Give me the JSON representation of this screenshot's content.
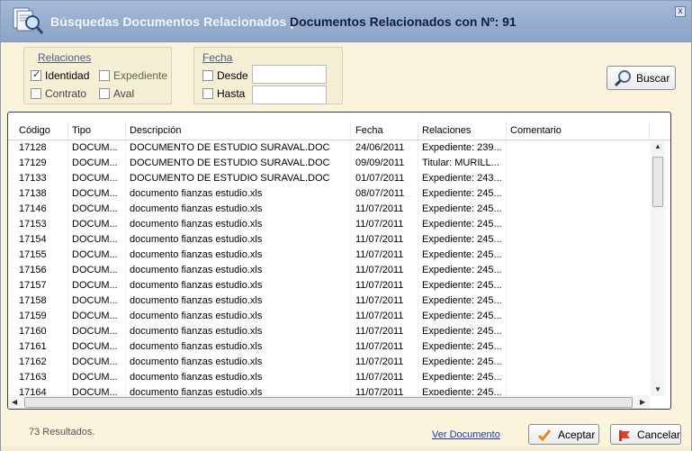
{
  "window": {
    "title": "Búsquedas Documentos Relacionados |",
    "subtitle": "Documentos Relacionados con  Nº: 91",
    "close_glyph": "x"
  },
  "filters": {
    "relaciones": {
      "title": "Relaciones",
      "options": [
        {
          "label": "Identidad",
          "checked": true
        },
        {
          "label": "Expediente",
          "checked": false
        },
        {
          "label": "Contrato",
          "checked": false
        },
        {
          "label": "Aval",
          "checked": false
        }
      ]
    },
    "fecha": {
      "title": "Fecha",
      "desde_label": "Desde",
      "hasta_label": "Hasta",
      "desde_value": "",
      "hasta_value": ""
    }
  },
  "toolbar": {
    "search_label": "Buscar"
  },
  "grid": {
    "columns": [
      "Código",
      "Tipo",
      "Descripción",
      "Fecha",
      "Relaciones",
      "Comentario"
    ],
    "rows": [
      [
        "17128",
        "DOCUM...",
        "DOCUMENTO DE ESTUDIO SURAVAL.DOC",
        "24/06/2011",
        "Expediente: 239...",
        ""
      ],
      [
        "17129",
        "DOCUM...",
        "DOCUMENTO DE ESTUDIO SURAVAL.DOC",
        "09/09/2011",
        "Titular: MURILL...",
        ""
      ],
      [
        "17133",
        "DOCUM...",
        "DOCUMENTO DE ESTUDIO SURAVAL.DOC",
        "01/07/2011",
        "Expediente: 243...",
        ""
      ],
      [
        "17138",
        "DOCUM...",
        "documento fianzas estudio.xls",
        "08/07/2011",
        "Expediente: 245...",
        ""
      ],
      [
        "17146",
        "DOCUM...",
        "documento fianzas estudio.xls",
        "11/07/2011",
        "Expediente: 245...",
        ""
      ],
      [
        "17153",
        "DOCUM...",
        "documento fianzas estudio.xls",
        "11/07/2011",
        "Expediente: 245...",
        ""
      ],
      [
        "17154",
        "DOCUM...",
        "documento fianzas estudio.xls",
        "11/07/2011",
        "Expediente: 245...",
        ""
      ],
      [
        "17155",
        "DOCUM...",
        "documento fianzas estudio.xls",
        "11/07/2011",
        "Expediente: 245...",
        ""
      ],
      [
        "17156",
        "DOCUM...",
        "documento fianzas estudio.xls",
        "11/07/2011",
        "Expediente: 245...",
        ""
      ],
      [
        "17157",
        "DOCUM...",
        "documento fianzas estudio.xls",
        "11/07/2011",
        "Expediente: 245...",
        ""
      ],
      [
        "17158",
        "DOCUM...",
        "documento fianzas estudio.xls",
        "11/07/2011",
        "Expediente: 245...",
        ""
      ],
      [
        "17159",
        "DOCUM...",
        "documento fianzas estudio.xls",
        "11/07/2011",
        "Expediente: 245...",
        ""
      ],
      [
        "17160",
        "DOCUM...",
        "documento fianzas estudio.xls",
        "11/07/2011",
        "Expediente: 245...",
        ""
      ],
      [
        "17161",
        "DOCUM...",
        "documento fianzas estudio.xls",
        "11/07/2011",
        "Expediente: 245...",
        ""
      ],
      [
        "17162",
        "DOCUM...",
        "documento fianzas estudio.xls",
        "11/07/2011",
        "Expediente: 245...",
        ""
      ],
      [
        "17163",
        "DOCUM...",
        "documento fianzas estudio.xls",
        "11/07/2011",
        "Expediente: 245...",
        ""
      ],
      [
        "17164",
        "DOCUM...",
        "documento fianzas estudio.xls",
        "11/07/2011",
        "Expediente: 245...",
        ""
      ]
    ]
  },
  "footer": {
    "status": "73 Resultados.",
    "link": "Ver Documento",
    "accept_label": "Aceptar",
    "cancel_label": "Cancelar"
  },
  "colors": {
    "header_bg": "#8ca4c8",
    "body_bg": "#fbf4dc",
    "link": "#1a3bb0"
  }
}
